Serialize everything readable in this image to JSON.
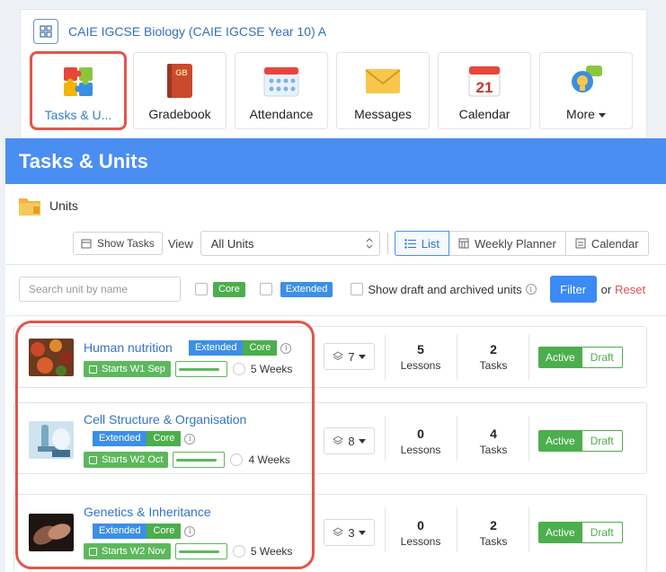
{
  "course": {
    "title": "CAIE IGCSE Biology (CAIE IGCSE Year 10) A"
  },
  "apps": [
    {
      "label": "Tasks & U...",
      "icon": "puzzle-icon"
    },
    {
      "label": "Gradebook",
      "icon": "gradebook-icon",
      "badge": "GB"
    },
    {
      "label": "Attendance",
      "icon": "attendance-icon"
    },
    {
      "label": "Messages",
      "icon": "envelope-icon"
    },
    {
      "label": "Calendar",
      "icon": "calendar-icon",
      "day": "21"
    },
    {
      "label": "More",
      "icon": "more-apps-icon"
    }
  ],
  "panel": {
    "title": "Tasks & Units"
  },
  "units_header": {
    "label": "Units"
  },
  "toolbar": {
    "show_tasks": "Show Tasks",
    "view_label": "View",
    "view_select": "All Units",
    "list": "List",
    "weekly_planner": "Weekly Planner",
    "calendar": "Calendar"
  },
  "filters": {
    "search_placeholder": "Search unit by name",
    "core": "Core",
    "extended": "Extended",
    "show_draft": "Show draft and archived units",
    "filter": "Filter",
    "or": "or",
    "reset": "Reset"
  },
  "units": [
    {
      "title": "Human nutrition",
      "tag1": "Extended",
      "tag2": "Core",
      "starts": "Starts W1 Sep",
      "progress": 0.9,
      "weeks": "5 Weeks",
      "count": "7",
      "lessons_n": "5",
      "lessons_t": "Lessons",
      "tasks_n": "2",
      "tasks_t": "Tasks",
      "active": "Active",
      "draft": "Draft"
    },
    {
      "title": "Cell Structure & Organisation",
      "tag1": "Extended",
      "tag2": "Core",
      "starts": "Starts W2 Oct",
      "progress": 0.9,
      "weeks": "4 Weeks",
      "count": "8",
      "lessons_n": "0",
      "lessons_t": "Lessons",
      "tasks_n": "4",
      "tasks_t": "Tasks",
      "active": "Active",
      "draft": "Draft"
    },
    {
      "title": "Genetics & Inheritance",
      "tag1": "Extended",
      "tag2": "Core",
      "starts": "Starts W2 Nov",
      "progress": 0.9,
      "weeks": "5 Weeks",
      "count": "3",
      "lessons_n": "0",
      "lessons_t": "Lessons",
      "tasks_n": "2",
      "tasks_t": "Tasks",
      "active": "Active",
      "draft": "Draft"
    }
  ],
  "colors": {
    "accent": "#4a8ef2",
    "highlight": "#e2554a",
    "green": "#5cb85c",
    "link": "#3273c6"
  }
}
